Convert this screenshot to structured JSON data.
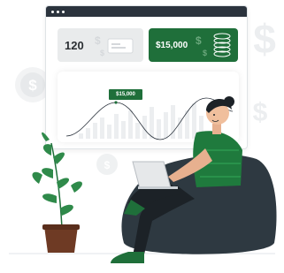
{
  "dashboard": {
    "count_card": {
      "value": "120",
      "icon": "dollar-card-icon"
    },
    "amount_card": {
      "value": "$15,000",
      "icon": "dollar-coins-icon"
    },
    "chart": {
      "tooltip": "$15,000"
    }
  },
  "decor": {
    "background_icons": [
      "dollar-coin-icon",
      "dollar-sign-icon"
    ],
    "colors": {
      "accent": "#1f6f3a",
      "titlebar": "#2b333d",
      "beanbag": "#2e3941",
      "shirt": "#1f7a3d"
    }
  }
}
